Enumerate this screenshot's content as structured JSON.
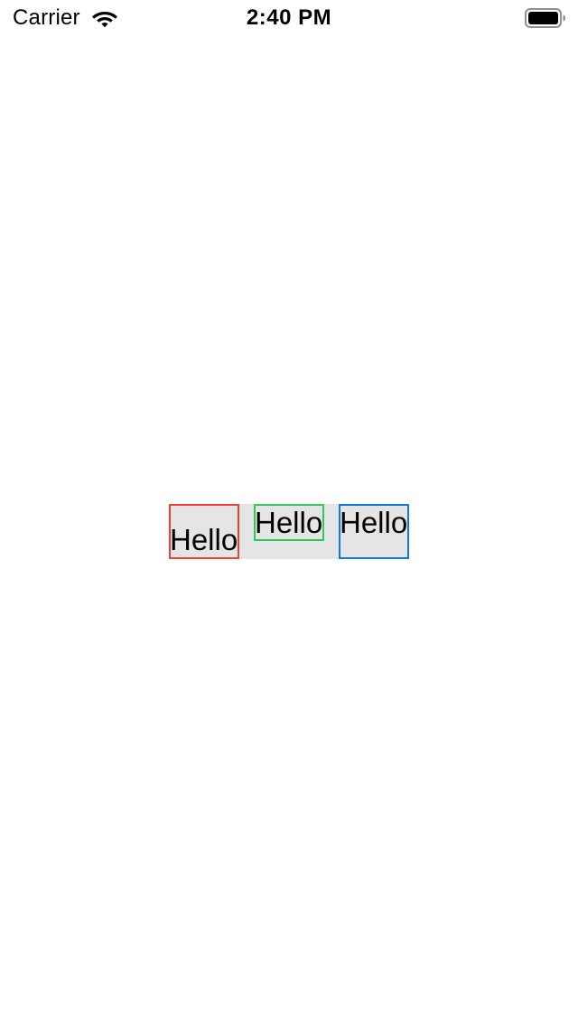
{
  "status_bar": {
    "carrier": "Carrier",
    "time": "2:40 PM",
    "wifi_icon": "wifi-icon",
    "battery_icon": "battery-full-icon"
  },
  "hello_stack": {
    "items": [
      {
        "label": "Hello",
        "border_color": "#eb4335",
        "alignment": "bottom"
      },
      {
        "label": "Hello",
        "border_color": "#34c759",
        "alignment": "top"
      },
      {
        "label": "Hello",
        "border_color": "#0a78e6",
        "alignment": "top"
      }
    ],
    "background_color": "#e5e5e5"
  }
}
